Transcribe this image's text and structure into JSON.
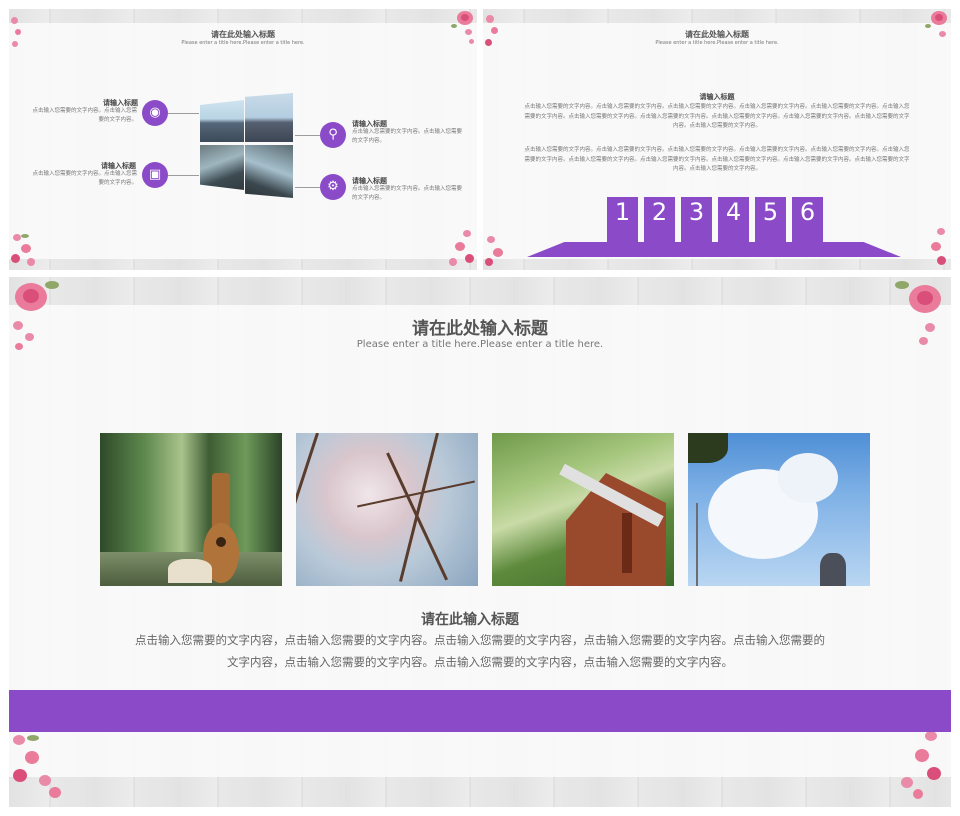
{
  "colors": {
    "accent": "#8b4bc9",
    "wood": "#e2e2e2",
    "paper": "#fafafa",
    "flower": "#ea7b9b",
    "leaf": "#8fa86a"
  },
  "slide1": {
    "title": "请在此处输入标题",
    "subtitle": "Please enter a title here.Please enter a title here.",
    "features": [
      {
        "label": "请输入标题",
        "desc": "点击输入您需要的文字内容。点击输入您需要的文字内容。",
        "icon": "eye-icon"
      },
      {
        "label": "请输入标题",
        "desc": "点击输入您需要的文字内容。点击输入您需要的文字内容。",
        "icon": "lock-icon"
      },
      {
        "label": "请输入标题",
        "desc": "点击输入您需要的文字内容。点击输入您需要的文字内容。",
        "icon": "key-icon"
      },
      {
        "label": "请输入标题",
        "desc": "点击输入您需要的文字内容。点击输入您需要的文字内容。",
        "icon": "gear-icon"
      }
    ]
  },
  "slide2": {
    "title": "请在此处输入标题",
    "subtitle": "Please enter a title here.Please enter a title here.",
    "heading": "请输入标题",
    "paragraphs": [
      "点击输入您需要的文字内容。点击输入您需要的文字内容。点击输入您需要的文字内容。点击输入您需要的文字内容。点击输入您需要的文字内容。点击输入您需要的文字内容。点击输入您需要的文字内容。点击输入您需要的文字内容。点击输入您需要的文字内容。点击输入您需要的文字内容。点击输入您需要的文字内容。点击输入您需要的文字内容。",
      "点击输入您需要的文字内容。点击输入您需要的文字内容。点击输入您需要的文字内容。点击输入您需要的文字内容。点击输入您需要的文字内容。点击输入您需要的文字内容。点击输入您需要的文字内容。点击输入您需要的文字内容。点击输入您需要的文字内容。点击输入您需要的文字内容。点击输入您需要的文字内容。点击输入您需要的文字内容。"
    ],
    "steps": [
      "1",
      "2",
      "3",
      "4",
      "5",
      "6"
    ]
  },
  "slide3": {
    "title": "请在此处输入标题",
    "subtitle": "Please enter a title here.Please enter a title here.",
    "heading": "请在此输入标题",
    "paragraph_line1": "点击输入您需要的文字内容，点击输入您需要的文字内容。点击输入您需要的文字内容，点击输入您需要的文字内容。点击输入您需要的",
    "paragraph_line2": "文字内容，点击输入您需要的文字内容。点击输入您需要的文字内容，点击输入您需要的文字内容。"
  }
}
